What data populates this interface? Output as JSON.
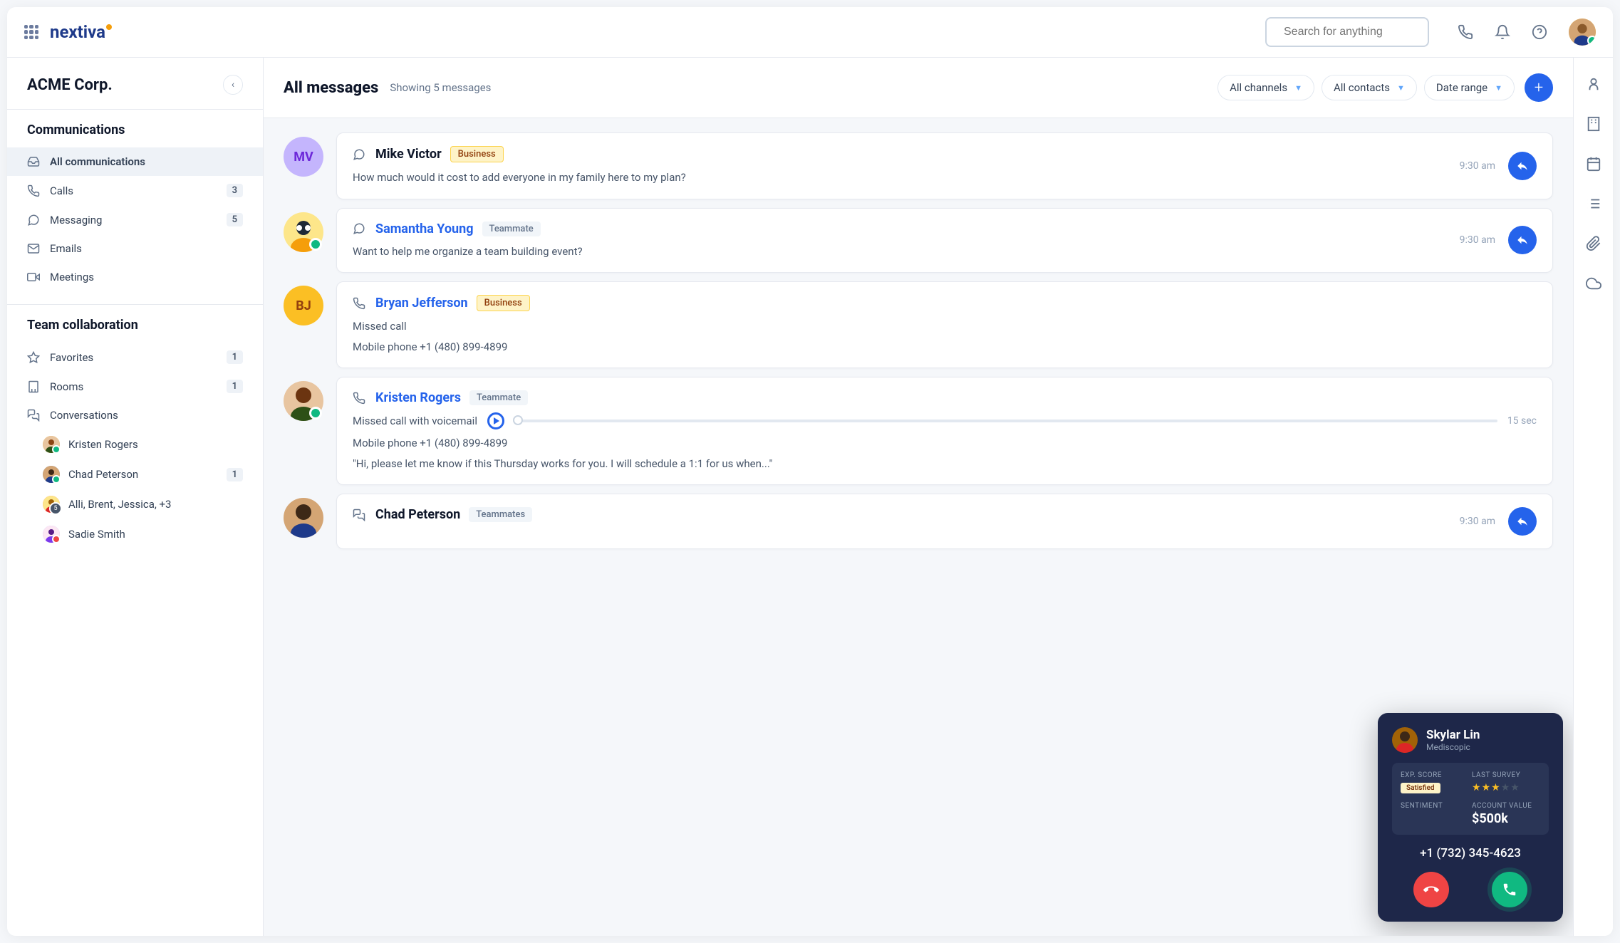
{
  "brand": "nextiva",
  "search": {
    "placeholder": "Search for anything"
  },
  "org": {
    "name": "ACME Corp."
  },
  "sidebar": {
    "communications_title": "Communications",
    "team_title": "Team collaboration",
    "comm_items": [
      {
        "label": "All communications",
        "badge": ""
      },
      {
        "label": "Calls",
        "badge": "3"
      },
      {
        "label": "Messaging",
        "badge": "5"
      },
      {
        "label": "Emails",
        "badge": ""
      },
      {
        "label": "Meetings",
        "badge": ""
      }
    ],
    "team_items": [
      {
        "label": "Favorites",
        "badge": "1"
      },
      {
        "label": "Rooms",
        "badge": "1"
      },
      {
        "label": "Conversations",
        "badge": ""
      }
    ],
    "conversations": [
      {
        "label": "Kristen Rogers",
        "badge": ""
      },
      {
        "label": "Chad Peterson",
        "badge": "1"
      },
      {
        "label": "Alli, Brent, Jessica, +3",
        "badge": ""
      },
      {
        "label": "Sadie Smith",
        "badge": ""
      }
    ]
  },
  "main": {
    "title": "All messages",
    "subtitle": "Showing 5 messages",
    "filters": [
      "All channels",
      "All contacts",
      "Date range"
    ]
  },
  "messages": [
    {
      "name": "Mike Victor",
      "initials": "MV",
      "tag_type": "business",
      "tag_text": "Business",
      "time": "9:30 am",
      "lines": [
        "How much would it cost to add everyone in my family here to my plan?"
      ]
    },
    {
      "name": "Samantha Young",
      "tag_type": "teammate",
      "tag_text": "Teammate",
      "time": "9:30 am",
      "lines": [
        "Want to help me organize a team building event?"
      ]
    },
    {
      "name": "Bryan Jefferson",
      "initials": "BJ",
      "tag_type": "business",
      "tag_text": "Business",
      "lines": [
        "Missed call",
        "Mobile phone +1 (480) 899-4899"
      ]
    },
    {
      "name": "Kristen Rogers",
      "tag_type": "teammate",
      "tag_text": "Teammate",
      "vm_label": "Missed call with voicemail",
      "vm_duration": "15 sec",
      "lines": [
        "Mobile phone +1 (480) 899-4899",
        "\"Hi, please let me know if this Thursday works for you. I will schedule a 1:1 for us when...\""
      ]
    },
    {
      "name": "Chad Peterson",
      "tag_type": "teammate",
      "tag_text": "Teammates",
      "time": "9:30 am"
    }
  ],
  "call": {
    "name": "Skylar Lin",
    "company": "Mediscopic",
    "labels": {
      "exp": "EXP. SCORE",
      "survey": "LAST SURVEY",
      "sentiment": "SENTIMENT",
      "account": "ACCOUNT VALUE"
    },
    "exp_badge": "Satisfied",
    "stars": 3,
    "account_value": "$500k",
    "phone": "+1 (732) 345-4623"
  }
}
